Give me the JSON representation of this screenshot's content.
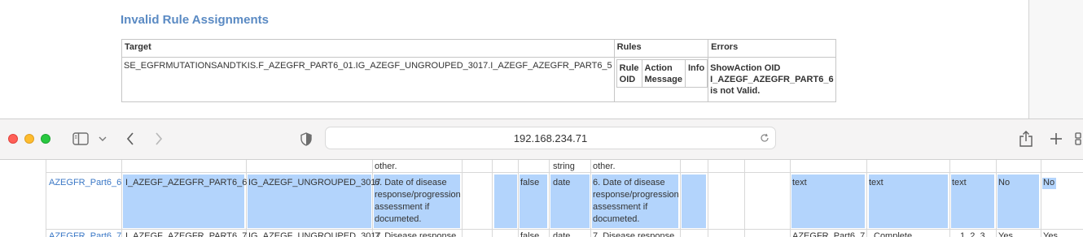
{
  "top_page": {
    "section_title": "Invalid Rule Assignments",
    "table": {
      "headers": [
        "Target",
        "Rules",
        "Errors"
      ],
      "target": "SE_EGFRMUTATIONSANDTKIS.F_AZEGFR_PART6_01.IG_AZEGF_UNGROUPED_3017.I_AZEGF_AZEGFR_PART6_5",
      "rules_headers": {
        "oid_1": "Rule",
        "oid_2": "OID",
        "action_1": "Action",
        "action_2": "Message",
        "info": "Info"
      },
      "error_lines": [
        "ShowAction OID",
        "I_AZEGF_AZEGFR_PART6_6",
        "is not Valid."
      ]
    }
  },
  "browser": {
    "url": "192.168.234.71",
    "colors": {
      "close": "#ff5f57",
      "minimize": "#febc2e",
      "zoom": "#28c840"
    }
  },
  "grid": {
    "partial_row": {
      "col3": "other.",
      "col7": "string",
      "col8": "other."
    },
    "row1": {
      "link": "AZEGFR_Part6_6",
      "item_oid": "I_AZEGF_AZEGFR_PART6_6",
      "group_oid": "IG_AZEGF_UNGROUPED_3017",
      "question": [
        "6. Date of disease",
        "response/progression",
        "assessment if",
        "documeted."
      ],
      "flag": "false",
      "data_type": "date",
      "question2": [
        "6. Date of disease",
        "response/progression",
        "assessment if",
        "documeted."
      ],
      "type1": "text",
      "type2": "text",
      "type3": "text",
      "req1": "No",
      "req2": "No"
    },
    "row2": {
      "link": "AZEGFR_Part6_7",
      "item_oid": "I_AZEGF_AZEGFR_PART6_7",
      "group_oid": "IG_AZEGF_UNGROUPED_3017",
      "question": "7. Disease response",
      "flag": "false",
      "data_type": "date",
      "question2": "7. Disease response",
      "c1": "AZEGFR_Part6_7",
      "c2": "Complete",
      "c3": "1, 2, 3",
      "req1": "Yes",
      "req2": "Yes"
    },
    "selection_color": "#b3d4fc",
    "link_color": "#3b78c6"
  }
}
